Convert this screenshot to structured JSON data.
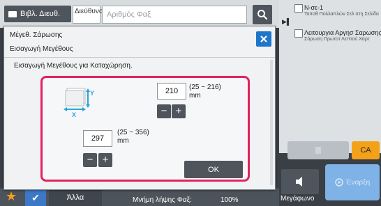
{
  "header": {
    "address_book_button": "Βιβλ. Διευθ.",
    "address_label": "Διεύθυνση",
    "fax_number_placeholder": "Αριθμός Φαξ"
  },
  "job_list": [
    {
      "title": "Ν-σε-1",
      "subtitle": "Τοποθ Πολλαπλών Σελ στη Σελίδα"
    },
    {
      "title": "Λειτουργια Αργησ Σαρωσης",
      "subtitle": "Σάρωση Πρωτοτ Λεπτού Χαρτ"
    }
  ],
  "right_buttons": {
    "ca": "CA",
    "speaker": "Μεγάφωνο",
    "send": "Έναρξη"
  },
  "bottom_bar": {
    "other": "Άλλα",
    "receive_memory_label": "Μνήμη λήψης Φαξ:",
    "receive_memory_value": "100%"
  },
  "dialog": {
    "title": "Μέγεθ. Σάρωσης",
    "subtitle": "Εισαγωγή Μεγέθους",
    "instruction": "Εισαγωγή Μεγέθους για Καταχώρηση.",
    "y_value": "210",
    "y_range": "(25 ~ 216)",
    "y_unit": "mm",
    "x_value": "297",
    "x_range": "(25 ~ 356)",
    "x_unit": "mm",
    "minus_label": "−",
    "plus_label": "+",
    "ok_label": "OK",
    "paper_axis_y": "Y",
    "paper_axis_x": "X"
  },
  "colors": {
    "highlight_frame": "#e0245e",
    "close_button": "#1f75c9",
    "ca_button": "#f4a11a",
    "send_button": "#7fb2e6"
  }
}
